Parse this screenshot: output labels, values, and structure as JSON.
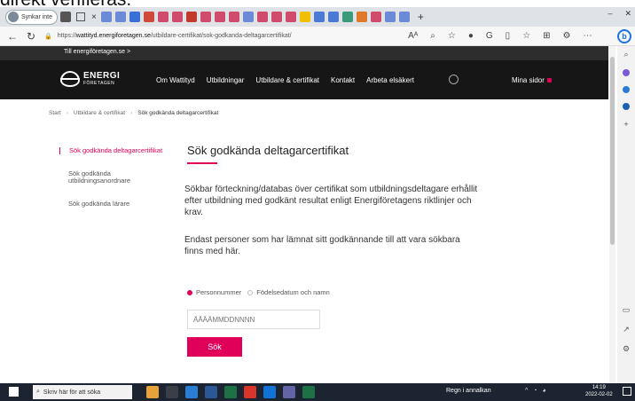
{
  "caption_fragment": "direkt verifieras.",
  "browser": {
    "profile_label": "Synkar inte",
    "url_prefix": "https://",
    "url_domain": "wattityd.energiforetagen.se",
    "url_path": "/utbildare-certifikat/sok-godkanda-deltagarcertifikat/",
    "read_aloud": "Aᴬ"
  },
  "site": {
    "top_link": "Till energiföretagen.se >",
    "logo_line1": "ENERGI",
    "logo_line2": "FÖRETAGEN",
    "nav": [
      "Om Wattityd",
      "Utbildningar",
      "Utbildare & certifikat",
      "Kontakt",
      "Arbeta elsäkert"
    ],
    "mina_sidor": "Mina sidor"
  },
  "breadcrumb": {
    "start": "Start",
    "level2": "Utbildare & certifikat",
    "current": "Sök godkända deltagarcertifikat"
  },
  "sidemenu": {
    "items": [
      "Sök godkända deltagarcertifikat",
      "Sök godkända utbildningsanordnare",
      "Sök godkända lärare"
    ]
  },
  "content": {
    "title": "Sök godkända deltagarcertifikat",
    "para1": "Sökbar förteckning/databas över certifikat som utbildningsdeltagare erhållit efter utbildning med godkänt resultat enligt Energiföretagens riktlinjer och krav.",
    "para2": "Endast personer som har lämnat sitt godkännande till att vara sökbara finns med här.",
    "radio_personnummer": "Personnummer",
    "radio_fodelsedatum": "Födelsedatum och namn",
    "selected_radio": "Personnummer",
    "input_placeholder": "ÅÅÅÅMMDDNNNN",
    "search_button": "Sök"
  },
  "taskbar": {
    "search_placeholder": "Skriv här för att söka",
    "weather": "Regn i annalkan",
    "time": "14:19",
    "date": "2022-02-02"
  },
  "colors": {
    "accent": "#e0005a",
    "header_bg": "#161616",
    "taskbar_bg": "#1b2430"
  }
}
